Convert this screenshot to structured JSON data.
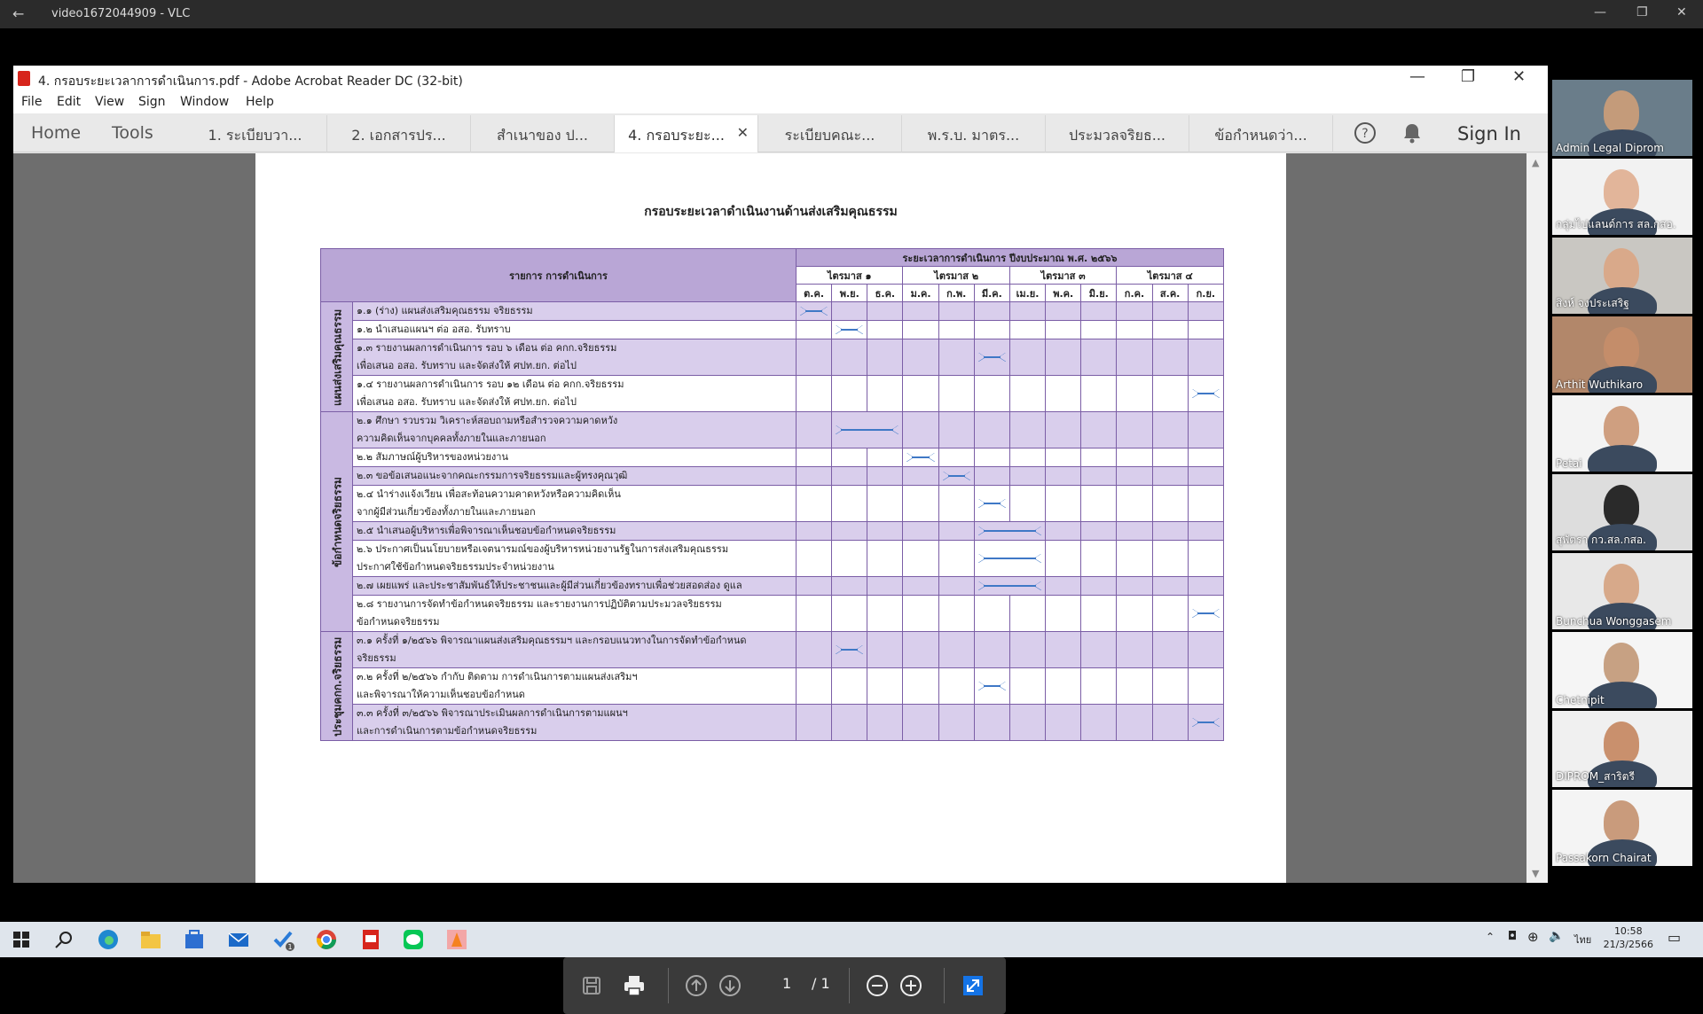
{
  "vlc": {
    "title": "video1672044909 - VLC"
  },
  "acrobat": {
    "title": "4. กรอบระยะเวลาการดำเนินการ.pdf - Adobe Acrobat Reader DC (32-bit)",
    "menu": [
      "File",
      "Edit",
      "View",
      "Sign",
      "Window",
      "Help"
    ],
    "nav": {
      "home": "Home",
      "tools": "Tools",
      "signin": "Sign In"
    },
    "tabs": [
      "1. ระเบียบวา...",
      "2. เอกสารปร...",
      "สำเนาของ ป...",
      "4. กรอบระยะ...",
      "ระเบียบคณะ...",
      "พ.ร.บ. มาตร...",
      "ประมวลจริยธ...",
      "ข้อกำหนดว่า..."
    ],
    "active_tab_index": 3,
    "page_current": "1",
    "page_total": "/ 1"
  },
  "document": {
    "title": "กรอบระยะเวลาดำเนินงานด้านส่งเสริมคุณธรรม",
    "header_task": "รายการ การดำเนินการ",
    "header_period": "ระยะเวลาการดำเนินการ ปีงบประมาณ พ.ศ. ๒๕๖๖",
    "quarters": [
      "ไตรมาส ๑",
      "ไตรมาส ๒",
      "ไตรมาส ๓",
      "ไตรมาส ๔"
    ],
    "months": [
      "ต.ค.",
      "พ.ย.",
      "ธ.ค.",
      "ม.ค.",
      "ก.พ.",
      "มี.ค.",
      "เม.ย.",
      "พ.ค.",
      "มิ.ย.",
      "ก.ค.",
      "ส.ค.",
      "ก.ย."
    ],
    "categories": [
      "แผนส่งเสริมคุณธรรม",
      "ข้อกำหนดจริยธรรม",
      "ประชุมคกก.จริยธรรม"
    ],
    "rows": [
      {
        "cat": 0,
        "text": [
          "๑.๑ (ร่าง) แผนส่งเสริมคุณธรรม จริยธรรม"
        ],
        "start": 0,
        "end": 0
      },
      {
        "cat": 0,
        "text": [
          "๑.๒ นำเสนอแผนฯ ต่อ อสอ. รับทราบ"
        ],
        "start": 1,
        "end": 1
      },
      {
        "cat": 0,
        "text": [
          "๑.๓ รายงานผลการดำเนินการ รอบ ๖ เดือน ต่อ คกก.จริยธรรม",
          "เพื่อเสนอ อสอ. รับทราบ และจัดส่งให้ ศปท.ยก. ต่อไป"
        ],
        "start": 5,
        "end": 5
      },
      {
        "cat": 0,
        "text": [
          "๑.๔ รายงานผลการดำเนินการ รอบ ๑๒ เดือน ต่อ คกก.จริยธรรม",
          "เพื่อเสนอ อสอ. รับทราบ และจัดส่งให้ ศปท.ยก. ต่อไป"
        ],
        "start": 11,
        "end": 11
      },
      {
        "cat": 1,
        "text": [
          "๒.๑ ศึกษา รวบรวม วิเคราะห์สอบถามหรือสำรวจความคาดหวัง",
          "ความคิดเห็นจากบุคคลทั้งภายในและภายนอก"
        ],
        "start": 1,
        "end": 2
      },
      {
        "cat": 1,
        "text": [
          "๒.๒ สัมภาษณ์ผู้บริหารของหน่วยงาน"
        ],
        "start": 3,
        "end": 3
      },
      {
        "cat": 1,
        "text": [
          "๒.๓ ขอข้อเสนอแนะจากคณะกรรมการจริยธรรมและผู้ทรงคุณวุฒิ"
        ],
        "start": 4,
        "end": 4
      },
      {
        "cat": 1,
        "text": [
          "๒.๔ นำร่างแจ้งเวียน เพื่อสะท้อนความคาดหวังหรือความคิดเห็น",
          "จากผู้มีส่วนเกี่ยวข้องทั้งภายในและภายนอก"
        ],
        "start": 5,
        "end": 5
      },
      {
        "cat": 1,
        "text": [
          "๒.๕ นำเสนอผู้บริหารเพื่อพิจารณาเห็นชอบข้อกำหนดจริยธรรม"
        ],
        "start": 5,
        "end": 6
      },
      {
        "cat": 1,
        "text": [
          "๒.๖ ประกาศเป็นนโยบายหรือเจตนารมณ์ของผู้บริหารหน่วยงานรัฐในการส่งเสริมคุณธรรม",
          "ประกาศใช้ข้อกำหนดจริยธรรมประจำหน่วยงาน"
        ],
        "start": 5,
        "end": 6
      },
      {
        "cat": 1,
        "text": [
          "๒.๗ เผยแพร่ และประชาสัมพันธ์ให้ประชาชนและผู้มีส่วนเกี่ยวข้องทราบเพื่อช่วยสอดส่อง ดูแล"
        ],
        "start": 5,
        "end": 6
      },
      {
        "cat": 1,
        "text": [
          "๒.๘ รายงานการจัดทำข้อกำหนดจริยธรรม และรายงานการปฏิบัติตามประมวลจริยธรรม",
          "ข้อกำหนดจริยธรรม"
        ],
        "start": 11,
        "end": 11
      },
      {
        "cat": 2,
        "text": [
          "๓.๑ ครั้งที่ ๑/๒๕๖๖ พิจารณาแผนส่งเสริมคุณธรรมฯ และกรอบแนวทางในการจัดทำข้อกำหนด",
          "จริยธรรม"
        ],
        "start": 1,
        "end": 1
      },
      {
        "cat": 2,
        "text": [
          "๓.๒ ครั้งที่ ๒/๒๕๖๖ กำกับ ติดตาม การดำเนินการตามแผนส่งเสริมฯ",
          "และพิจารณาให้ความเห็นชอบข้อกำหนด"
        ],
        "start": 5,
        "end": 5
      },
      {
        "cat": 2,
        "text": [
          "๓.๓ ครั้งที่ ๓/๒๕๖๖ พิจารณาประเมินผลการดำเนินการตามแผนฯ",
          "และการดำเนินการตามข้อกำหนดจริยธรรม"
        ],
        "start": 11,
        "end": 11
      }
    ]
  },
  "participants": [
    "Admin Legal Diprom",
    "กลุ่มไปแลนด์การ สล.กสอ.",
    "สิงห์ จงประเสริฐ",
    "Arthit Wuthikaro",
    "Petai",
    "สุพัตรา กว.สล.กสอ.",
    "Bunchua Wonggasem",
    "Chetnipit",
    "DIPROM_สาริตรี",
    "Passakorn Chairat"
  ],
  "taskbar": {
    "time": "10:58",
    "date": "21/3/2566",
    "lang": "ไทย"
  }
}
